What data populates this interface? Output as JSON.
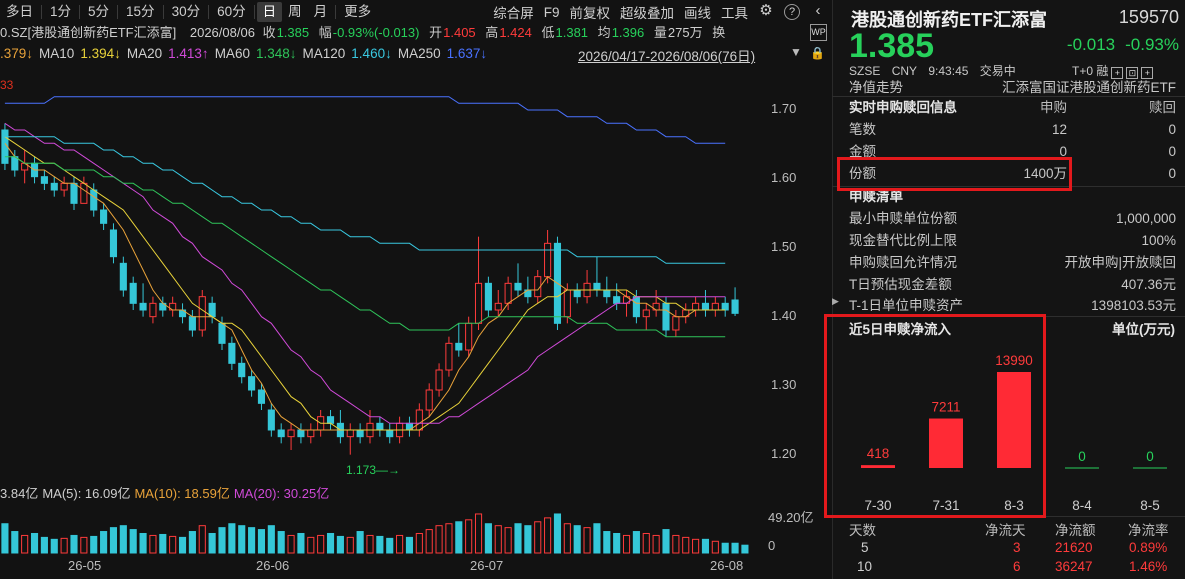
{
  "toolbar": {
    "timeframes": [
      "多日",
      "1分",
      "5分",
      "15分",
      "30分",
      "60分",
      "日",
      "周",
      "月",
      "更多"
    ],
    "active_timeframe": "日",
    "right_items": [
      "综合屏",
      "F9",
      "前复权",
      "超级叠加",
      "画线",
      "工具"
    ],
    "gear_icon": "gear-icon",
    "help_icon": "question-icon",
    "collapse_icon": "chevron-left-icon"
  },
  "quote_line": {
    "code_name": "0.SZ[港股通创新药ETF汇添富]",
    "date": "2026/08/06",
    "close_label": "收",
    "close": "1.385",
    "change_label": "幅",
    "change": "-0.93%(-0.013)",
    "open_label": "开",
    "open": "1.405",
    "high_label": "高",
    "high": "1.424",
    "low_label": "低",
    "low": "1.381",
    "avg_label": "均",
    "avg": "1.396",
    "vol_label": "量",
    "vol": "275万",
    "turnover_label": "换"
  },
  "ma_line": [
    {
      "text": ".379↓",
      "color": "#e8a23a"
    },
    {
      "text": "MA10",
      "color": "#cfcfcf"
    },
    {
      "text": "1.394↓",
      "color": "#e8d23a"
    },
    {
      "text": "MA20",
      "color": "#cfcfcf"
    },
    {
      "text": "1.413↑",
      "color": "#d04ad8"
    },
    {
      "text": "MA60",
      "color": "#cfcfcf"
    },
    {
      "text": "1.348↓",
      "color": "#2fc45a"
    },
    {
      "text": "MA120",
      "color": "#cfcfcf"
    },
    {
      "text": "1.460↓",
      "color": "#39c8e0"
    },
    {
      "text": "MA250",
      "color": "#cfcfcf"
    },
    {
      "text": "1.637↓",
      "color": "#4a72ff"
    }
  ],
  "date_range": "2026/04/17-2026/08/06(76日)",
  "w_badge": "WP",
  "top_red_label": "33",
  "price_axis": [
    "1.70",
    "1.60",
    "1.50",
    "1.40",
    "1.30",
    "1.20"
  ],
  "low_annotation": "1.173",
  "volume_line": [
    {
      "text": "3.84亿",
      "color": "#cfcfcf"
    },
    {
      "text": "MA(5): 16.09亿",
      "color": "#cfcfcf"
    },
    {
      "text": "MA(10): 18.59亿",
      "color": "#e8a23a"
    },
    {
      "text": "MA(20): 30.25亿",
      "color": "#d04ad8"
    }
  ],
  "volume_axis": [
    "49.20亿",
    "0"
  ],
  "months": [
    "26-05",
    "26-06",
    "26-07",
    "26-08"
  ],
  "right": {
    "title": "港股通创新药ETF汇添富",
    "code": "159570",
    "price": "1.385",
    "change": "-0.013",
    "change_pct": "-0.93%",
    "exchange": "SZSE",
    "currency": "CNY",
    "time": "9:43:45",
    "status": "交易中",
    "t0": "T+0 融",
    "nav_row": {
      "k": "净值走势",
      "v": "汇添富国证港股通创新药ETF"
    },
    "realtime": {
      "k": "实时申购赎回信息",
      "h1": "申购",
      "h2": "赎回"
    },
    "rows": [
      {
        "k": "笔数",
        "v1": "12",
        "v2": "0"
      },
      {
        "k": "金额",
        "v1": "0",
        "v2": "0"
      },
      {
        "k": "份额",
        "v1": "1400万",
        "v2": "0"
      }
    ],
    "list_title": "申赎清单",
    "list": [
      {
        "k": "最小申赎单位份额",
        "v": "1,000,000"
      },
      {
        "k": "现金替代比例上限",
        "v": "100%"
      },
      {
        "k": "申购赎回允许情况",
        "v": "开放申购|开放赎回"
      },
      {
        "k": "T日预估现金差额",
        "v": "407.36元"
      },
      {
        "k": "T-1日单位申赎资产",
        "v": "1398103.53元"
      }
    ],
    "flow_title": "近5日申赎净流入",
    "flow_unit": "单位(万元)",
    "flow": [
      {
        "date": "7-30",
        "value": 418
      },
      {
        "date": "7-31",
        "value": 7211
      },
      {
        "date": "8-3",
        "value": 13990
      },
      {
        "date": "8-4",
        "value": 0
      },
      {
        "date": "8-5",
        "value": 0
      }
    ],
    "table_headers": [
      "天数",
      "净流天",
      "净流额",
      "净流率"
    ],
    "table_rows": [
      [
        "5",
        "3",
        "21620",
        "0.89%"
      ],
      [
        "10",
        "6",
        "36247",
        "1.46%"
      ]
    ],
    "colors": {
      "up": "#ff3030",
      "down": "#27d15b",
      "highlight": "#e3191c"
    }
  },
  "chart_data": {
    "type": "candlestick",
    "ylim": [
      1.15,
      1.75
    ],
    "candles": [
      {
        "o": 1.66,
        "h": 1.67,
        "l": 1.6,
        "c": 1.61
      },
      {
        "o": 1.62,
        "h": 1.63,
        "l": 1.59,
        "c": 1.6
      },
      {
        "o": 1.6,
        "h": 1.63,
        "l": 1.58,
        "c": 1.61
      },
      {
        "o": 1.61,
        "h": 1.62,
        "l": 1.58,
        "c": 1.59
      },
      {
        "o": 1.59,
        "h": 1.6,
        "l": 1.57,
        "c": 1.58
      },
      {
        "o": 1.58,
        "h": 1.59,
        "l": 1.56,
        "c": 1.57
      },
      {
        "o": 1.57,
        "h": 1.59,
        "l": 1.56,
        "c": 1.58
      },
      {
        "o": 1.58,
        "h": 1.59,
        "l": 1.54,
        "c": 1.55
      },
      {
        "o": 1.55,
        "h": 1.59,
        "l": 1.55,
        "c": 1.58
      },
      {
        "o": 1.57,
        "h": 1.58,
        "l": 1.53,
        "c": 1.54
      },
      {
        "o": 1.54,
        "h": 1.55,
        "l": 1.51,
        "c": 1.52
      },
      {
        "o": 1.51,
        "h": 1.52,
        "l": 1.46,
        "c": 1.47
      },
      {
        "o": 1.46,
        "h": 1.47,
        "l": 1.41,
        "c": 1.42
      },
      {
        "o": 1.43,
        "h": 1.44,
        "l": 1.39,
        "c": 1.4
      },
      {
        "o": 1.4,
        "h": 1.43,
        "l": 1.38,
        "c": 1.39
      },
      {
        "o": 1.38,
        "h": 1.41,
        "l": 1.37,
        "c": 1.4
      },
      {
        "o": 1.4,
        "h": 1.41,
        "l": 1.38,
        "c": 1.39
      },
      {
        "o": 1.39,
        "h": 1.41,
        "l": 1.38,
        "c": 1.4
      },
      {
        "o": 1.39,
        "h": 1.4,
        "l": 1.37,
        "c": 1.38
      },
      {
        "o": 1.38,
        "h": 1.39,
        "l": 1.35,
        "c": 1.36
      },
      {
        "o": 1.36,
        "h": 1.42,
        "l": 1.35,
        "c": 1.41
      },
      {
        "o": 1.4,
        "h": 1.41,
        "l": 1.37,
        "c": 1.38
      },
      {
        "o": 1.37,
        "h": 1.38,
        "l": 1.33,
        "c": 1.34
      },
      {
        "o": 1.34,
        "h": 1.35,
        "l": 1.3,
        "c": 1.31
      },
      {
        "o": 1.31,
        "h": 1.32,
        "l": 1.28,
        "c": 1.29
      },
      {
        "o": 1.29,
        "h": 1.3,
        "l": 1.26,
        "c": 1.27
      },
      {
        "o": 1.27,
        "h": 1.28,
        "l": 1.24,
        "c": 1.25
      },
      {
        "o": 1.24,
        "h": 1.25,
        "l": 1.2,
        "c": 1.21
      },
      {
        "o": 1.21,
        "h": 1.22,
        "l": 1.19,
        "c": 1.2
      },
      {
        "o": 1.2,
        "h": 1.22,
        "l": 1.18,
        "c": 1.21
      },
      {
        "o": 1.21,
        "h": 1.22,
        "l": 1.19,
        "c": 1.2
      },
      {
        "o": 1.2,
        "h": 1.22,
        "l": 1.19,
        "c": 1.21
      },
      {
        "o": 1.21,
        "h": 1.24,
        "l": 1.2,
        "c": 1.23
      },
      {
        "o": 1.23,
        "h": 1.24,
        "l": 1.21,
        "c": 1.22
      },
      {
        "o": 1.22,
        "h": 1.24,
        "l": 1.19,
        "c": 1.2
      },
      {
        "o": 1.2,
        "h": 1.22,
        "l": 1.173,
        "c": 1.21
      },
      {
        "o": 1.21,
        "h": 1.22,
        "l": 1.19,
        "c": 1.2
      },
      {
        "o": 1.2,
        "h": 1.24,
        "l": 1.19,
        "c": 1.22
      },
      {
        "o": 1.22,
        "h": 1.23,
        "l": 1.2,
        "c": 1.21
      },
      {
        "o": 1.21,
        "h": 1.22,
        "l": 1.19,
        "c": 1.2
      },
      {
        "o": 1.2,
        "h": 1.23,
        "l": 1.19,
        "c": 1.22
      },
      {
        "o": 1.22,
        "h": 1.23,
        "l": 1.2,
        "c": 1.21
      },
      {
        "o": 1.21,
        "h": 1.25,
        "l": 1.2,
        "c": 1.24
      },
      {
        "o": 1.24,
        "h": 1.28,
        "l": 1.23,
        "c": 1.27
      },
      {
        "o": 1.27,
        "h": 1.31,
        "l": 1.26,
        "c": 1.3
      },
      {
        "o": 1.3,
        "h": 1.35,
        "l": 1.29,
        "c": 1.34
      },
      {
        "o": 1.34,
        "h": 1.37,
        "l": 1.32,
        "c": 1.33
      },
      {
        "o": 1.33,
        "h": 1.38,
        "l": 1.32,
        "c": 1.37
      },
      {
        "o": 1.37,
        "h": 1.5,
        "l": 1.36,
        "c": 1.43
      },
      {
        "o": 1.43,
        "h": 1.44,
        "l": 1.38,
        "c": 1.39
      },
      {
        "o": 1.39,
        "h": 1.42,
        "l": 1.38,
        "c": 1.4
      },
      {
        "o": 1.4,
        "h": 1.44,
        "l": 1.39,
        "c": 1.43
      },
      {
        "o": 1.43,
        "h": 1.46,
        "l": 1.41,
        "c": 1.42
      },
      {
        "o": 1.42,
        "h": 1.44,
        "l": 1.4,
        "c": 1.41
      },
      {
        "o": 1.41,
        "h": 1.45,
        "l": 1.4,
        "c": 1.44
      },
      {
        "o": 1.44,
        "h": 1.51,
        "l": 1.43,
        "c": 1.49
      },
      {
        "o": 1.49,
        "h": 1.5,
        "l": 1.36,
        "c": 1.37
      },
      {
        "o": 1.38,
        "h": 1.43,
        "l": 1.37,
        "c": 1.42
      },
      {
        "o": 1.42,
        "h": 1.43,
        "l": 1.4,
        "c": 1.41
      },
      {
        "o": 1.41,
        "h": 1.45,
        "l": 1.4,
        "c": 1.43
      },
      {
        "o": 1.43,
        "h": 1.47,
        "l": 1.41,
        "c": 1.42
      },
      {
        "o": 1.42,
        "h": 1.44,
        "l": 1.4,
        "c": 1.41
      },
      {
        "o": 1.41,
        "h": 1.43,
        "l": 1.39,
        "c": 1.4
      },
      {
        "o": 1.4,
        "h": 1.42,
        "l": 1.38,
        "c": 1.41
      },
      {
        "o": 1.41,
        "h": 1.42,
        "l": 1.37,
        "c": 1.38
      },
      {
        "o": 1.38,
        "h": 1.4,
        "l": 1.36,
        "c": 1.39
      },
      {
        "o": 1.39,
        "h": 1.42,
        "l": 1.38,
        "c": 1.4
      },
      {
        "o": 1.4,
        "h": 1.41,
        "l": 1.35,
        "c": 1.36
      },
      {
        "o": 1.36,
        "h": 1.39,
        "l": 1.35,
        "c": 1.38
      },
      {
        "o": 1.38,
        "h": 1.4,
        "l": 1.37,
        "c": 1.39
      },
      {
        "o": 1.39,
        "h": 1.41,
        "l": 1.38,
        "c": 1.4
      },
      {
        "o": 1.4,
        "h": 1.42,
        "l": 1.38,
        "c": 1.39
      },
      {
        "o": 1.39,
        "h": 1.41,
        "l": 1.38,
        "c": 1.4
      },
      {
        "o": 1.4,
        "h": 1.41,
        "l": 1.38,
        "c": 1.39
      },
      {
        "o": 1.405,
        "h": 1.424,
        "l": 1.381,
        "c": 1.385
      }
    ],
    "ma": {
      "MA5": {
        "color": "#e8a23a",
        "values": [
          1.64,
          1.62,
          1.61,
          1.6,
          1.6,
          1.59,
          1.58,
          1.58,
          1.57,
          1.56,
          1.55,
          1.53,
          1.51,
          1.48,
          1.45,
          1.42,
          1.4,
          1.39,
          1.39,
          1.38,
          1.38,
          1.38,
          1.37,
          1.36,
          1.33,
          1.3,
          1.28,
          1.25,
          1.23,
          1.22,
          1.21,
          1.21,
          1.21,
          1.21,
          1.21,
          1.21,
          1.21,
          1.21,
          1.21,
          1.21,
          1.21,
          1.21,
          1.22,
          1.23,
          1.25,
          1.27,
          1.3,
          1.32,
          1.35,
          1.37,
          1.38,
          1.4,
          1.41,
          1.42,
          1.42,
          1.44,
          1.43,
          1.42,
          1.42,
          1.42,
          1.42,
          1.42,
          1.42,
          1.41,
          1.4,
          1.4,
          1.39,
          1.39,
          1.38,
          1.38,
          1.39,
          1.39,
          1.39,
          1.39
        ]
      },
      "MA10": {
        "color": "#e8d23a",
        "values": [
          1.65,
          1.64,
          1.63,
          1.62,
          1.61,
          1.61,
          1.6,
          1.59,
          1.58,
          1.57,
          1.56,
          1.55,
          1.54,
          1.52,
          1.5,
          1.48,
          1.46,
          1.44,
          1.42,
          1.4,
          1.39,
          1.38,
          1.37,
          1.37,
          1.36,
          1.34,
          1.32,
          1.3,
          1.28,
          1.26,
          1.25,
          1.23,
          1.22,
          1.22,
          1.21,
          1.21,
          1.21,
          1.21,
          1.21,
          1.21,
          1.21,
          1.21,
          1.21,
          1.22,
          1.23,
          1.24,
          1.25,
          1.27,
          1.29,
          1.31,
          1.33,
          1.35,
          1.37,
          1.39,
          1.4,
          1.41,
          1.41,
          1.42,
          1.42,
          1.42,
          1.42,
          1.42,
          1.42,
          1.42,
          1.41,
          1.41,
          1.41,
          1.4,
          1.4,
          1.39,
          1.39,
          1.39,
          1.39,
          1.39
        ]
      },
      "MA20": {
        "color": "#d04ad8",
        "values": [
          1.67,
          1.66,
          1.66,
          1.65,
          1.64,
          1.64,
          1.63,
          1.63,
          1.62,
          1.61,
          1.6,
          1.59,
          1.58,
          1.57,
          1.56,
          1.54,
          1.53,
          1.52,
          1.5,
          1.49,
          1.47,
          1.46,
          1.45,
          1.43,
          1.42,
          1.4,
          1.38,
          1.37,
          1.35,
          1.33,
          1.32,
          1.3,
          1.29,
          1.27,
          1.26,
          1.25,
          1.24,
          1.23,
          1.23,
          1.22,
          1.22,
          1.22,
          1.22,
          1.22,
          1.22,
          1.23,
          1.23,
          1.24,
          1.25,
          1.26,
          1.27,
          1.28,
          1.29,
          1.3,
          1.32,
          1.33,
          1.34,
          1.35,
          1.36,
          1.37,
          1.38,
          1.39,
          1.4,
          1.4,
          1.41,
          1.41,
          1.41,
          1.41,
          1.41,
          1.41,
          1.41,
          1.41,
          1.41,
          1.41
        ]
      },
      "MA60": {
        "color": "#2fc45a",
        "values": [
          1.62,
          1.62,
          1.61,
          1.61,
          1.61,
          1.61,
          1.6,
          1.6,
          1.6,
          1.6,
          1.59,
          1.59,
          1.58,
          1.58,
          1.57,
          1.57,
          1.56,
          1.55,
          1.55,
          1.54,
          1.53,
          1.52,
          1.52,
          1.51,
          1.5,
          1.49,
          1.48,
          1.47,
          1.46,
          1.45,
          1.44,
          1.43,
          1.42,
          1.42,
          1.41,
          1.4,
          1.39,
          1.39,
          1.38,
          1.37,
          1.37,
          1.36,
          1.36,
          1.36,
          1.36,
          1.36,
          1.37,
          1.37,
          1.37,
          1.38,
          1.38,
          1.38,
          1.38,
          1.38,
          1.38,
          1.38,
          1.38,
          1.38,
          1.37,
          1.37,
          1.37,
          1.37,
          1.36,
          1.36,
          1.36,
          1.36,
          1.36,
          1.35,
          1.35,
          1.35,
          1.35,
          1.35,
          1.35,
          1.35
        ]
      },
      "MA120": {
        "color": "#39c8e0",
        "values": [
          1.65,
          1.65,
          1.65,
          1.65,
          1.65,
          1.65,
          1.64,
          1.64,
          1.64,
          1.64,
          1.63,
          1.63,
          1.62,
          1.62,
          1.61,
          1.61,
          1.6,
          1.6,
          1.59,
          1.58,
          1.58,
          1.57,
          1.56,
          1.56,
          1.55,
          1.55,
          1.54,
          1.54,
          1.53,
          1.53,
          1.52,
          1.52,
          1.51,
          1.51,
          1.51,
          1.5,
          1.5,
          1.5,
          1.49,
          1.49,
          1.49,
          1.49,
          1.48,
          1.48,
          1.48,
          1.48,
          1.48,
          1.48,
          1.48,
          1.48,
          1.48,
          1.48,
          1.48,
          1.48,
          1.48,
          1.48,
          1.48,
          1.48,
          1.47,
          1.47,
          1.47,
          1.47,
          1.47,
          1.47,
          1.47,
          1.47,
          1.47,
          1.46,
          1.46,
          1.46,
          1.46,
          1.46,
          1.46,
          1.46
        ]
      },
      "MA250": {
        "color": "#4a72ff",
        "values": [
          1.7,
          1.7,
          1.7,
          1.7,
          1.7,
          1.71,
          1.71,
          1.71,
          1.71,
          1.71,
          1.71,
          1.71,
          1.71,
          1.71,
          1.71,
          1.71,
          1.71,
          1.71,
          1.71,
          1.71,
          1.71,
          1.71,
          1.71,
          1.71,
          1.71,
          1.71,
          1.71,
          1.71,
          1.71,
          1.71,
          1.71,
          1.71,
          1.71,
          1.71,
          1.71,
          1.71,
          1.71,
          1.71,
          1.71,
          1.71,
          1.71,
          1.71,
          1.71,
          1.71,
          1.71,
          1.71,
          1.7,
          1.7,
          1.7,
          1.7,
          1.7,
          1.7,
          1.7,
          1.69,
          1.69,
          1.69,
          1.69,
          1.68,
          1.68,
          1.68,
          1.68,
          1.67,
          1.67,
          1.67,
          1.66,
          1.66,
          1.66,
          1.65,
          1.65,
          1.65,
          1.64,
          1.64,
          1.64,
          1.64
        ]
      }
    },
    "volume_ylim": [
      0,
      49.2
    ],
    "volumes": [
      30,
      22,
      18,
      20,
      16,
      14,
      15,
      18,
      16,
      17,
      22,
      26,
      28,
      24,
      20,
      18,
      19,
      17,
      16,
      22,
      28,
      20,
      26,
      30,
      28,
      26,
      24,
      28,
      22,
      18,
      20,
      16,
      18,
      20,
      17,
      16,
      22,
      18,
      17,
      15,
      18,
      16,
      20,
      24,
      28,
      30,
      32,
      34,
      40,
      30,
      28,
      26,
      30,
      28,
      32,
      36,
      40,
      30,
      28,
      26,
      30,
      22,
      20,
      18,
      22,
      20,
      18,
      24,
      18,
      16,
      14,
      14,
      12,
      10,
      10,
      8
    ]
  }
}
